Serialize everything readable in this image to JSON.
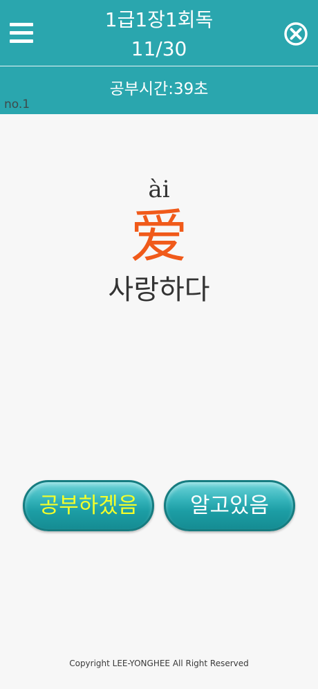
{
  "header": {
    "title": "1급1장1회독",
    "progress": "11/30",
    "menu_icon": "hamburger-menu-icon",
    "close_icon": "close-circle-icon"
  },
  "subheader": {
    "study_time": "공부시간:39초"
  },
  "card": {
    "number": "no.1",
    "pinyin": "ài",
    "hanzi": "爱",
    "meaning": "사랑하다"
  },
  "buttons": {
    "study_label": "공부하겠음",
    "know_label": "알고있음"
  },
  "footer": {
    "copyright": "Copyright LEE-YONGHEE All Right Reserved"
  },
  "colors": {
    "header_bg": "#2aa6ae",
    "hanzi": "#f05a1a",
    "study_label": "#f4ff2a"
  }
}
